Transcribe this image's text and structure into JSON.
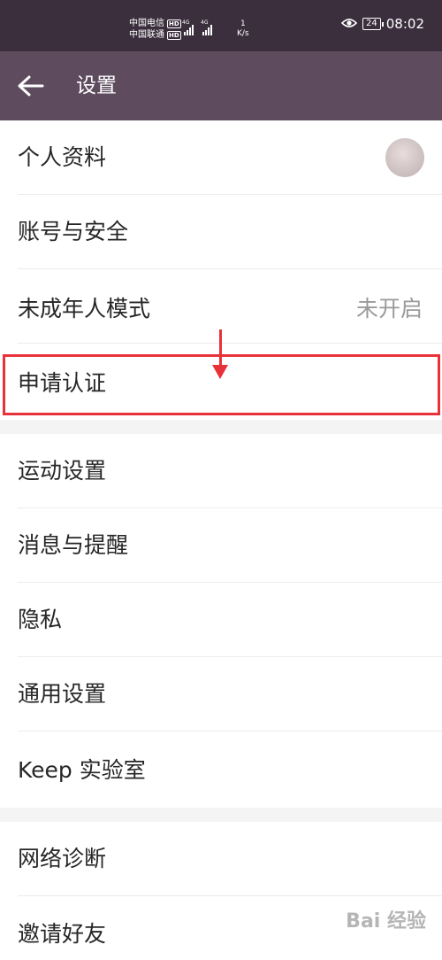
{
  "status_bar": {
    "carrier_1": "中国电信",
    "carrier_2": "中国联通",
    "hd_badge": "HD",
    "network_tag": "4G",
    "speed_value": "1",
    "speed_unit": "K/s",
    "battery": "24",
    "time": "08:02"
  },
  "header": {
    "title": "设置"
  },
  "menu": {
    "profile": "个人资料",
    "account_security": "账号与安全",
    "minor_mode": "未成年人模式",
    "minor_mode_value": "未开启",
    "apply_certification": "申请认证",
    "sport_settings": "运动设置",
    "notifications": "消息与提醒",
    "privacy": "隐私",
    "general": "通用设置",
    "keep_lab": "Keep 实验室",
    "network_diagnosis": "网络诊断",
    "invite_friends": "邀请好友"
  },
  "watermark": {
    "text": "Bai 经验"
  },
  "colors": {
    "status_bar_bg": "#3b2f3e",
    "app_bar_bg": "#5e4c5e",
    "highlight": "#e8323a"
  }
}
